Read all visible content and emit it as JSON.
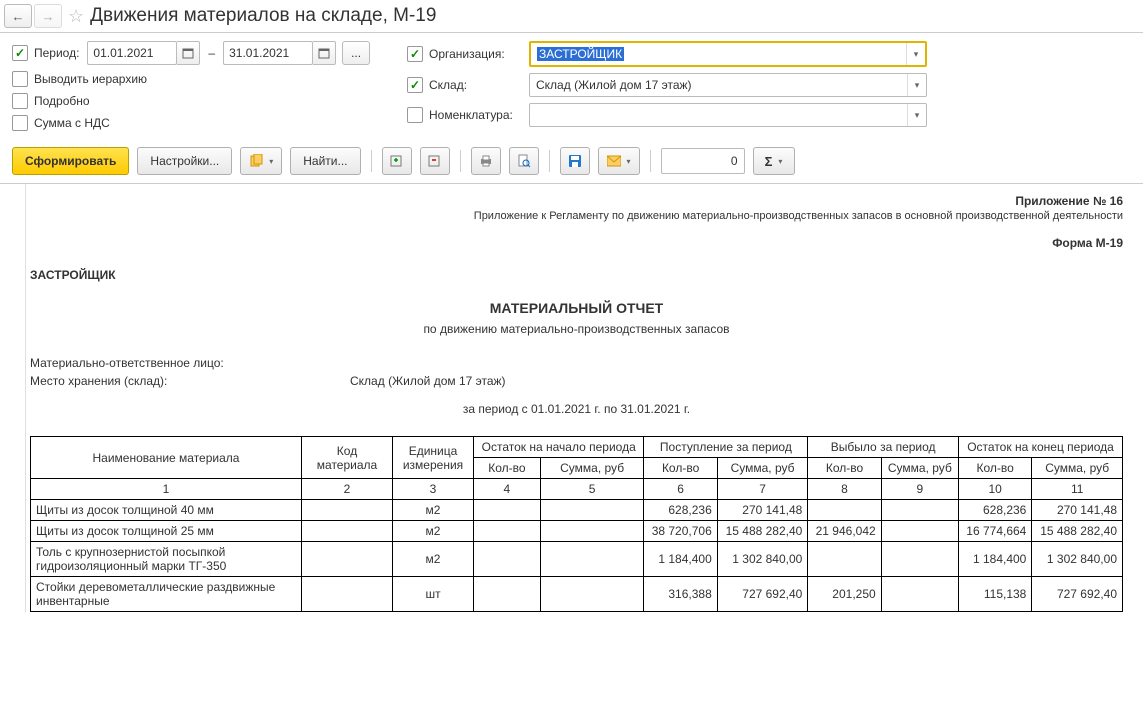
{
  "title": "Движения материалов на складе, М-19",
  "period": {
    "label": "Период:",
    "from": "01.01.2021",
    "to": "31.01.2021",
    "dash": "–"
  },
  "hierarchy_label": "Выводить иерархию",
  "detail_label": "Подробно",
  "vat_label": "Сумма с НДС",
  "org": {
    "label": "Организация:",
    "value": "ЗАСТРОЙЩИК"
  },
  "warehouse": {
    "label": "Склад:",
    "value": "Склад (Жилой дом 17 этаж)"
  },
  "nomenclature": {
    "label": "Номенклатура:",
    "value": ""
  },
  "toolbar": {
    "form": "Сформировать",
    "settings": "Настройки...",
    "find": "Найти...",
    "num": "0"
  },
  "report": {
    "appendix": "Приложение № 16",
    "appendix_sub": "Приложение к Регламенту по движению материально-производственных запасов в основной производственной деятельности",
    "form": "Форма М-19",
    "company": "ЗАСТРОЙЩИК",
    "title": "МАТЕРИАЛЬНЫЙ ОТЧЕТ",
    "subtitle": "по движению материально-производственных запасов",
    "mol_label": "Материально-ответственное лицо:",
    "mol_value": "",
    "store_label": "Место хранения (склад):",
    "store_value": "Склад (Жилой дом 17 этаж)",
    "period_text": "за период с 01.01.2021 г. по 31.01.2021 г.",
    "headers": {
      "name": "Наименование материала",
      "code": "Код материала",
      "unit": "Единица измерения",
      "start": "Остаток на начало периода",
      "in": "Поступление за период",
      "out": "Выбыло за период",
      "end": "Остаток на конец периода",
      "qty": "Кол-во",
      "sum": "Сумма, руб"
    },
    "colnums": [
      "1",
      "2",
      "3",
      "4",
      "5",
      "6",
      "7",
      "8",
      "9",
      "10",
      "11"
    ],
    "rows": [
      {
        "name": "Щиты из досок  толщиной 40 мм",
        "code": "",
        "unit": "м2",
        "sq": "",
        "ss": "",
        "iq": "628,236",
        "is": "270 141,48",
        "oq": "",
        "os": "",
        "eq": "628,236",
        "es": "270 141,48"
      },
      {
        "name": "Щиты из досок  толщиной 25 мм",
        "code": "",
        "unit": "м2",
        "sq": "",
        "ss": "",
        "iq": "38 720,706",
        "is": "15 488 282,40",
        "oq": "21 946,042",
        "os": "",
        "eq": "16 774,664",
        "es": "15 488 282,40"
      },
      {
        "name": "Толь с крупнозернистой посыпкой гидроизоляционный марки ТГ-350",
        "code": "",
        "unit": "м2",
        "sq": "",
        "ss": "",
        "iq": "1 184,400",
        "is": "1 302 840,00",
        "oq": "",
        "os": "",
        "eq": "1 184,400",
        "es": "1 302 840,00"
      },
      {
        "name": "Стойки деревометаллические раздвижные инвентарные",
        "code": "",
        "unit": "шт",
        "sq": "",
        "ss": "",
        "iq": "316,388",
        "is": "727 692,40",
        "oq": "201,250",
        "os": "",
        "eq": "115,138",
        "es": "727 692,40"
      }
    ]
  }
}
